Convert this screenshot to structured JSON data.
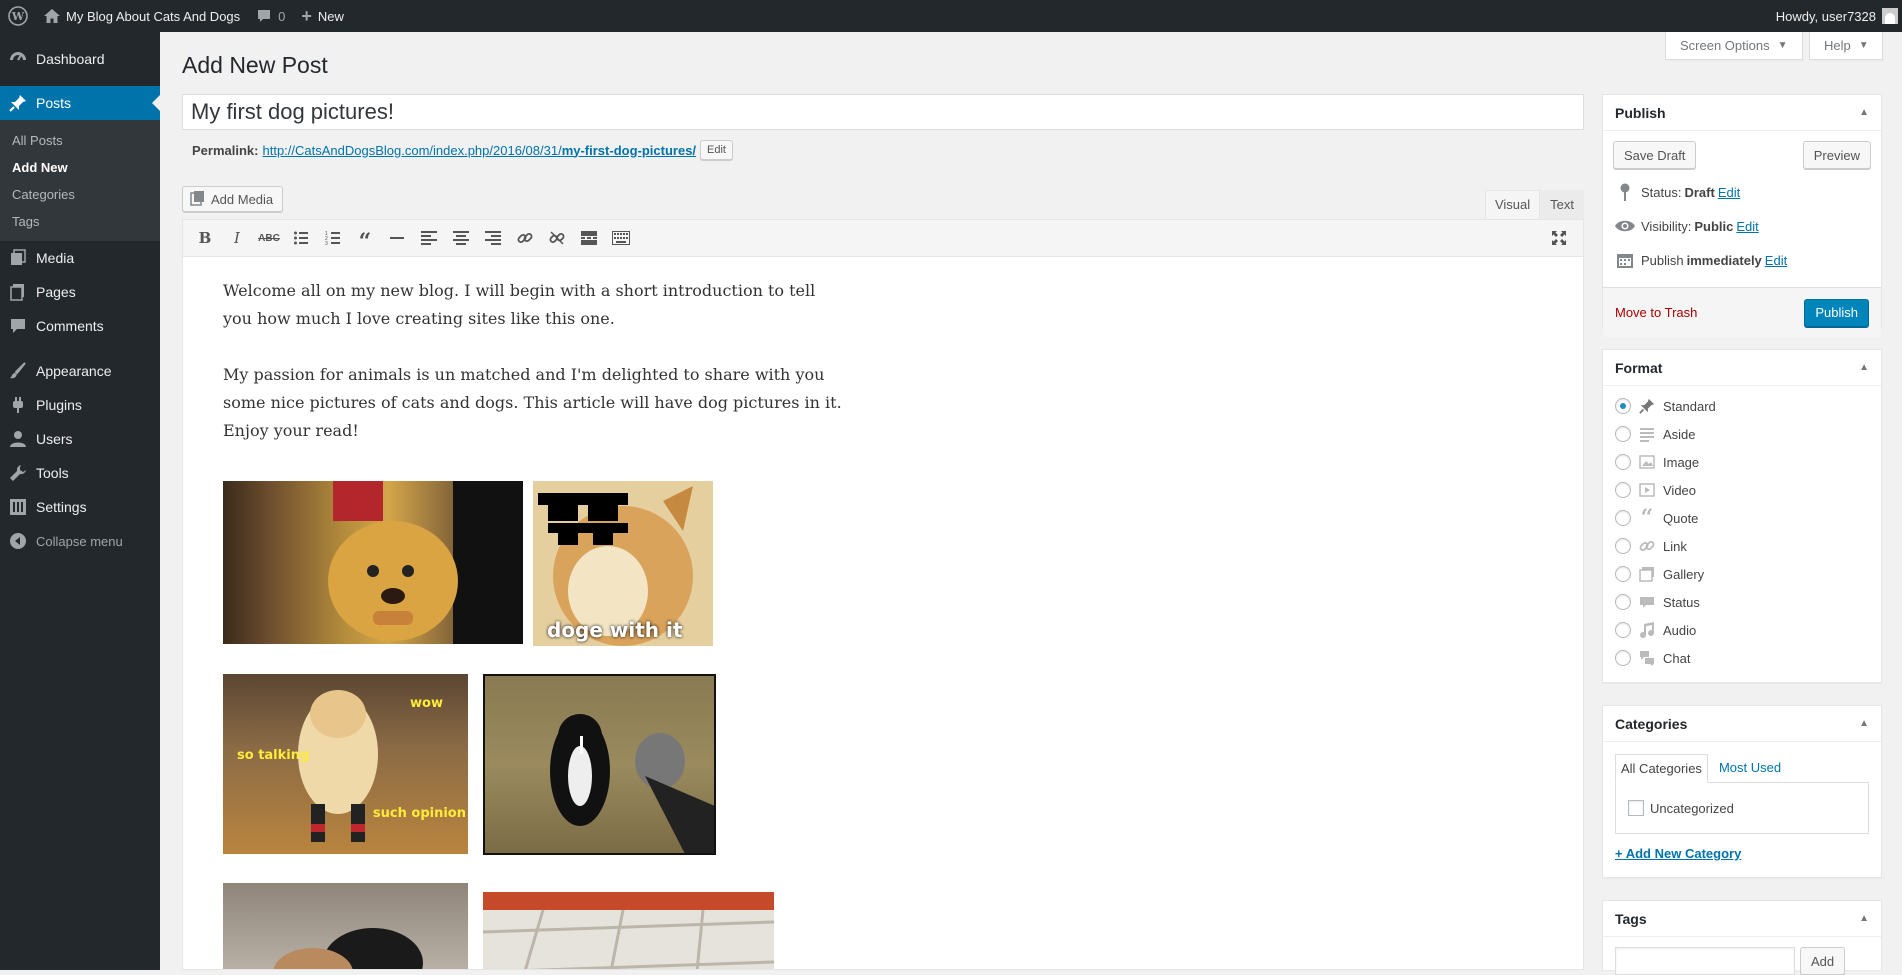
{
  "adminbar": {
    "site_name": "My Blog About Cats And Dogs",
    "comments_count": "0",
    "new_label": "New",
    "howdy": "Howdy, user7328"
  },
  "sidebar": {
    "items": [
      {
        "label": "Dashboard",
        "icon": "dashboard-icon"
      },
      {
        "label": "Posts",
        "icon": "pin-icon"
      },
      {
        "label": "Media",
        "icon": "media-icon"
      },
      {
        "label": "Pages",
        "icon": "pages-icon"
      },
      {
        "label": "Comments",
        "icon": "comment-icon"
      },
      {
        "label": "Appearance",
        "icon": "brush-icon"
      },
      {
        "label": "Plugins",
        "icon": "plugin-icon"
      },
      {
        "label": "Users",
        "icon": "users-icon"
      },
      {
        "label": "Tools",
        "icon": "wrench-icon"
      },
      {
        "label": "Settings",
        "icon": "settings-icon"
      }
    ],
    "posts_submenu": [
      "All Posts",
      "Add New",
      "Categories",
      "Tags"
    ],
    "collapse": "Collapse menu"
  },
  "header": {
    "title": "Add New Post",
    "screen_options": "Screen Options",
    "help": "Help"
  },
  "post": {
    "title": "My first dog pictures!",
    "permalink_label": "Permalink:",
    "permalink_base": "http://CatsAndDogsBlog.com/index.php/2016/08/31/",
    "permalink_slug": "my-first-dog-pictures/",
    "edit_label": "Edit"
  },
  "editor": {
    "add_media": "Add Media",
    "tab_visual": "Visual",
    "tab_text": "Text",
    "paragraphs": [
      "Welcome all on my new blog. I will begin with a short introduction to tell you how much I love creating sites like this one.",
      "My passion for animals is un matched and I'm delighted to share with you some nice pictures of cats and dogs. This article will have dog pictures in it. Enjoy your read!"
    ],
    "captions": {
      "doge": "doge with it",
      "wow": "wow",
      "so_talking": "so talking",
      "such_opinion": "such opinion"
    }
  },
  "publish": {
    "title": "Publish",
    "save_draft": "Save Draft",
    "preview": "Preview",
    "status_label": "Status:",
    "status_value": "Draft",
    "visibility_label": "Visibility:",
    "visibility_value": "Public",
    "publish_label": "Publish",
    "publish_value": "immediately",
    "edit": "Edit",
    "move_to_trash": "Move to Trash",
    "publish_button": "Publish"
  },
  "format": {
    "title": "Format",
    "options": [
      {
        "label": "Standard",
        "icon": "pin-icon",
        "checked": true
      },
      {
        "label": "Aside",
        "icon": "aside-icon"
      },
      {
        "label": "Image",
        "icon": "image-icon"
      },
      {
        "label": "Video",
        "icon": "video-icon"
      },
      {
        "label": "Quote",
        "icon": "quote-icon"
      },
      {
        "label": "Link",
        "icon": "link-icon"
      },
      {
        "label": "Gallery",
        "icon": "gallery-icon"
      },
      {
        "label": "Status",
        "icon": "status-icon"
      },
      {
        "label": "Audio",
        "icon": "audio-icon"
      },
      {
        "label": "Chat",
        "icon": "chat-icon"
      }
    ]
  },
  "categories": {
    "title": "Categories",
    "tab_all": "All Categories",
    "tab_most_used": "Most Used",
    "items": [
      "Uncategorized"
    ],
    "add_new": "+ Add New Category"
  },
  "tags": {
    "title": "Tags",
    "add": "Add"
  },
  "colors": {
    "accent": "#0073aa",
    "adminbar": "#23282d",
    "primary_button": "#0085ba"
  }
}
